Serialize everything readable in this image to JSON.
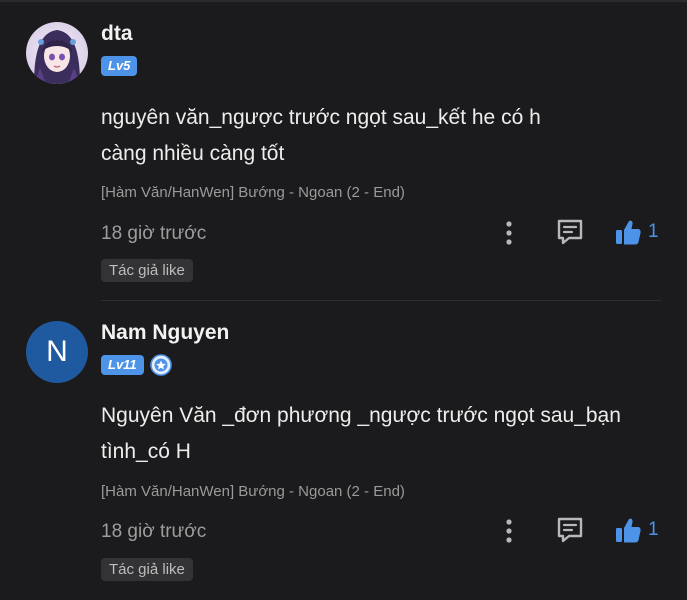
{
  "comments": [
    {
      "username": "dta",
      "level": "Lv5",
      "text": "nguyên văn_ngược trước ngọt sau_kết he có h càng nhiều càng tốt",
      "source": "[Hàm Văn/HanWen] Bướng - Ngoan (2 - End)",
      "time": "18 giờ trước",
      "likes": "1",
      "tag": "Tác giả like"
    },
    {
      "username": "Nam Nguyen",
      "avatar_letter": "N",
      "level": "Lv11",
      "text": "Nguyên Văn _đơn phương _ngược trước ngọt sau_bạn tình_có H",
      "source": "[Hàm Văn/HanWen] Bướng - Ngoan (2 - End)",
      "time": "18 giờ trước",
      "likes": "1",
      "tag": "Tác giả like"
    }
  ],
  "icons": {
    "more": "more-vertical-icon",
    "reply": "comment-icon",
    "like": "thumbs-up-icon",
    "medal": "badge-medal-icon"
  },
  "colors": {
    "background": "#1b1b1d",
    "accent": "#4d93e8",
    "avatar_blue": "#1f5aa0",
    "muted_text": "#9d9d9d",
    "tag_bg": "#333335"
  }
}
